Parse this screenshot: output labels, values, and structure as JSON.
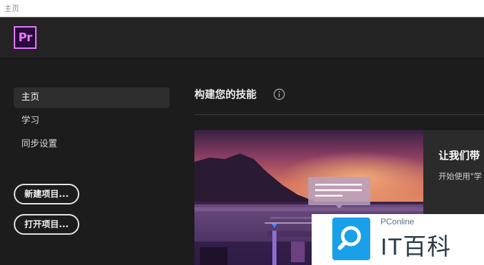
{
  "window": {
    "title": "主页"
  },
  "header": {
    "logo_text": "Pr"
  },
  "sidebar": {
    "items": [
      {
        "label": "主页",
        "active": true
      },
      {
        "label": "学习",
        "active": false
      },
      {
        "label": "同步设置",
        "active": false
      }
    ],
    "new_project_label": "新建项目...",
    "open_project_label": "打开项目..."
  },
  "main": {
    "section_title": "构建您的技能",
    "card": {
      "title": "让我们带",
      "subtitle": "开始使用\"学"
    }
  },
  "watermark": {
    "site": "PConline",
    "brand": "IT百科"
  },
  "colors": {
    "accent": "#e77bff",
    "background": "#1c1c1c",
    "brand_blue": "#1aa0e8"
  },
  "icons": [
    "info-icon",
    "search-icon"
  ]
}
